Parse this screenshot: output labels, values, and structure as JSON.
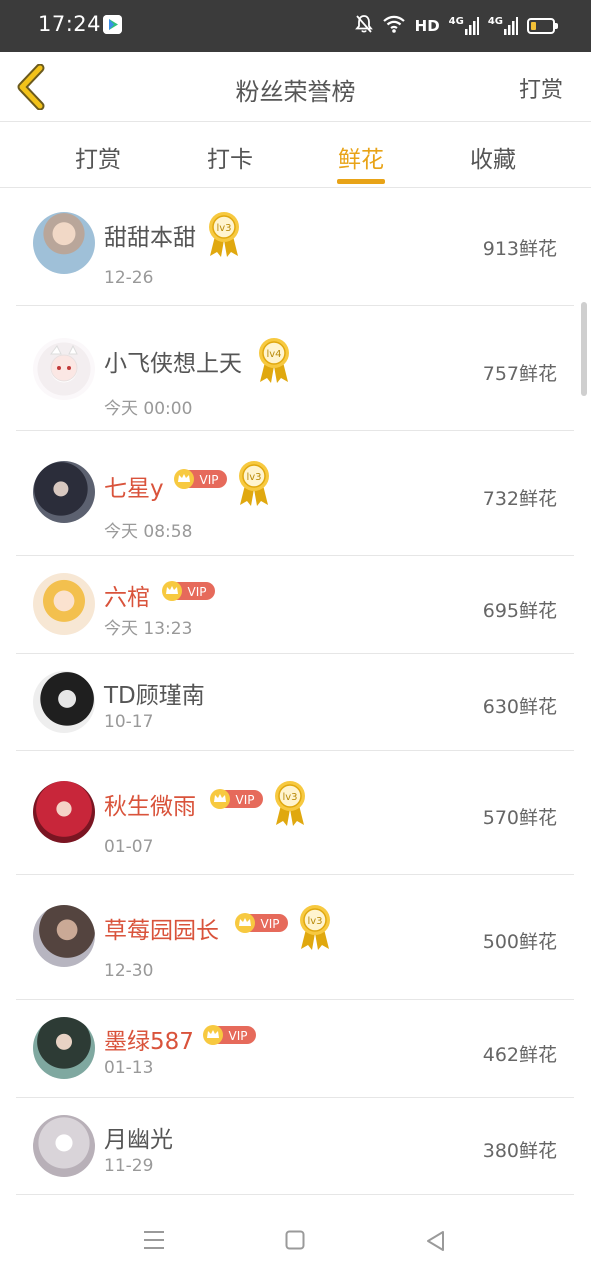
{
  "status_bar": {
    "time": "17:24",
    "hd_label": "HD",
    "net_label_1": "4G",
    "net_label_2": "4G"
  },
  "header": {
    "title": "粉丝荣誉榜",
    "action_label": "打赏"
  },
  "tabs": [
    {
      "label": "打赏"
    },
    {
      "label": "打卡"
    },
    {
      "label": "鲜花"
    },
    {
      "label": "收藏"
    }
  ],
  "colors": {
    "accent": "#e8a317",
    "vip_name": "#d9533b"
  },
  "vip_label": "VIP",
  "fans": [
    {
      "name": "甜甜本甜",
      "date": "12-26",
      "count": "913鲜花",
      "vip": false,
      "level": "lv3"
    },
    {
      "name": "小飞侠想上天",
      "date": "今天 00:00",
      "count": "757鲜花",
      "vip": false,
      "level": "lv4"
    },
    {
      "name": "七星y",
      "date": "今天 08:58",
      "count": "732鲜花",
      "vip": true,
      "level": "lv3"
    },
    {
      "name": "六棺",
      "date": "今天 13:23",
      "count": "695鲜花",
      "vip": true,
      "level": ""
    },
    {
      "name": "TD顾瑾南",
      "date": "10-17",
      "count": "630鲜花",
      "vip": false,
      "level": ""
    },
    {
      "name": "秋生微雨",
      "date": "01-07",
      "count": "570鲜花",
      "vip": true,
      "level": "lv3"
    },
    {
      "name": "草莓园园长",
      "date": "12-30",
      "count": "500鲜花",
      "vip": true,
      "level": "lv3"
    },
    {
      "name": "墨绿587",
      "date": "01-13",
      "count": "462鲜花",
      "vip": true,
      "level": ""
    },
    {
      "name": "月幽光",
      "date": "11-29",
      "count": "380鲜花",
      "vip": false,
      "level": ""
    }
  ]
}
